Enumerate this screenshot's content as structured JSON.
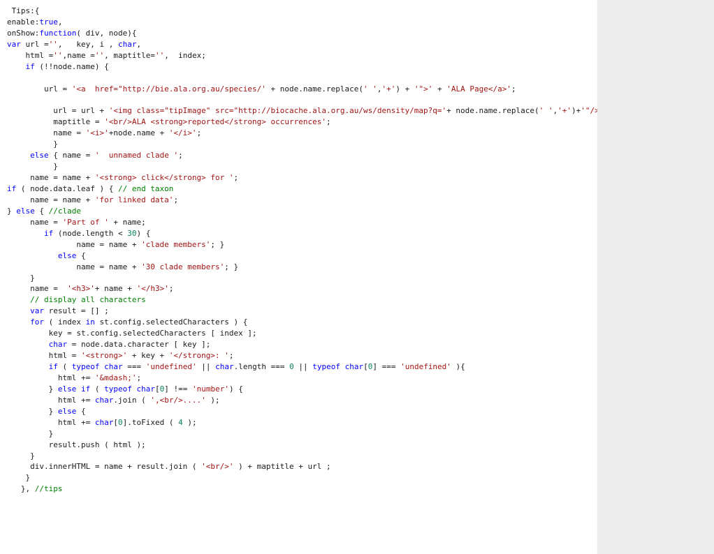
{
  "code_tokens": [
    {
      "indent": " ",
      "parts": [
        {
          "t": "Tips:{",
          "c": "p"
        }
      ]
    },
    {
      "indent": "",
      "parts": [
        {
          "t": "enable:",
          "c": "p"
        },
        {
          "t": "true",
          "c": "b"
        },
        {
          "t": ",",
          "c": "p"
        }
      ]
    },
    {
      "indent": "",
      "parts": [
        {
          "t": "onShow:",
          "c": "p"
        },
        {
          "t": "function",
          "c": "k"
        },
        {
          "t": "( div, node){",
          "c": "p"
        }
      ]
    },
    {
      "indent": "",
      "parts": [
        {
          "t": "var",
          "c": "k"
        },
        {
          "t": " url =",
          "c": "p"
        },
        {
          "t": "''",
          "c": "s"
        },
        {
          "t": ",   key, i , ",
          "c": "p"
        },
        {
          "t": "char",
          "c": "k"
        },
        {
          "t": ",",
          "c": "p"
        }
      ]
    },
    {
      "indent": "    ",
      "parts": [
        {
          "t": "html =",
          "c": "p"
        },
        {
          "t": "''",
          "c": "s"
        },
        {
          "t": ",name =",
          "c": "p"
        },
        {
          "t": "''",
          "c": "s"
        },
        {
          "t": ", maptitle=",
          "c": "p"
        },
        {
          "t": "''",
          "c": "s"
        },
        {
          "t": ",  index;",
          "c": "p"
        }
      ]
    },
    {
      "indent": "    ",
      "parts": [
        {
          "t": "if",
          "c": "k"
        },
        {
          "t": " (!!node.name) {",
          "c": "p"
        }
      ]
    },
    {
      "indent": "",
      "parts": []
    },
    {
      "indent": "        ",
      "parts": [
        {
          "t": "url = ",
          "c": "p"
        },
        {
          "t": "'<a  href=\"http://bie.ala.org.au/species/'",
          "c": "s"
        },
        {
          "t": " + node.name.replace(",
          "c": "p"
        },
        {
          "t": "' '",
          "c": "s"
        },
        {
          "t": ",",
          "c": "p"
        },
        {
          "t": "'+'",
          "c": "s"
        },
        {
          "t": ") + ",
          "c": "p"
        },
        {
          "t": "'\">'",
          "c": "s"
        },
        {
          "t": " + ",
          "c": "p"
        },
        {
          "t": "'ALA Page</a>'",
          "c": "s"
        },
        {
          "t": ";",
          "c": "p"
        }
      ]
    },
    {
      "indent": "",
      "parts": []
    },
    {
      "indent": "          ",
      "parts": [
        {
          "t": "url = url + ",
          "c": "p"
        },
        {
          "t": "'<img class=\"tipImage\" src=\"http://biocache.ala.org.au/ws/density/map?q='",
          "c": "s"
        },
        {
          "t": "+ node.name.replace(",
          "c": "p"
        },
        {
          "t": "' '",
          "c": "s"
        },
        {
          "t": ",",
          "c": "p"
        },
        {
          "t": "'+'",
          "c": "s"
        },
        {
          "t": ")+",
          "c": "p"
        },
        {
          "t": "'\"/>'",
          "c": "s"
        },
        {
          "t": ";",
          "c": "p"
        }
      ]
    },
    {
      "indent": "          ",
      "parts": [
        {
          "t": "maptitle = ",
          "c": "p"
        },
        {
          "t": "'<br/>ALA <strong>reported</strong> occurrences'",
          "c": "s"
        },
        {
          "t": ";",
          "c": "p"
        }
      ]
    },
    {
      "indent": "          ",
      "parts": [
        {
          "t": "name = ",
          "c": "p"
        },
        {
          "t": "'<i>'",
          "c": "s"
        },
        {
          "t": "+node.name + ",
          "c": "p"
        },
        {
          "t": "'</i>'",
          "c": "s"
        },
        {
          "t": ";",
          "c": "p"
        }
      ]
    },
    {
      "indent": "          ",
      "parts": [
        {
          "t": "}",
          "c": "p"
        }
      ]
    },
    {
      "indent": "     ",
      "parts": [
        {
          "t": "else",
          "c": "k"
        },
        {
          "t": " { name = ",
          "c": "p"
        },
        {
          "t": "'  unnamed clade '",
          "c": "s"
        },
        {
          "t": ";",
          "c": "p"
        }
      ]
    },
    {
      "indent": "          ",
      "parts": [
        {
          "t": "}",
          "c": "p"
        }
      ]
    },
    {
      "indent": "     ",
      "parts": [
        {
          "t": "name = name + ",
          "c": "p"
        },
        {
          "t": "'<strong> click</strong> for '",
          "c": "s"
        },
        {
          "t": ";",
          "c": "p"
        }
      ]
    },
    {
      "indent": "",
      "parts": [
        {
          "t": "if",
          "c": "k"
        },
        {
          "t": " ( node.data.leaf ) { ",
          "c": "p"
        },
        {
          "t": "// end taxon",
          "c": "c"
        }
      ]
    },
    {
      "indent": "     ",
      "parts": [
        {
          "t": "name = name + ",
          "c": "p"
        },
        {
          "t": "'for linked data'",
          "c": "s"
        },
        {
          "t": ";",
          "c": "p"
        }
      ]
    },
    {
      "indent": "",
      "parts": [
        {
          "t": "} ",
          "c": "p"
        },
        {
          "t": "else",
          "c": "k"
        },
        {
          "t": " { ",
          "c": "p"
        },
        {
          "t": "//clade",
          "c": "c"
        }
      ]
    },
    {
      "indent": "     ",
      "parts": [
        {
          "t": "name = ",
          "c": "p"
        },
        {
          "t": "'Part of '",
          "c": "s"
        },
        {
          "t": " + name;",
          "c": "p"
        }
      ]
    },
    {
      "indent": "        ",
      "parts": [
        {
          "t": "if",
          "c": "k"
        },
        {
          "t": " (node.length < ",
          "c": "p"
        },
        {
          "t": "30",
          "c": "n"
        },
        {
          "t": ") {",
          "c": "p"
        }
      ]
    },
    {
      "indent": "               ",
      "parts": [
        {
          "t": "name = name + ",
          "c": "p"
        },
        {
          "t": "'clade members'",
          "c": "s"
        },
        {
          "t": "; }",
          "c": "p"
        }
      ]
    },
    {
      "indent": "           ",
      "parts": [
        {
          "t": "else",
          "c": "k"
        },
        {
          "t": " {",
          "c": "p"
        }
      ]
    },
    {
      "indent": "               ",
      "parts": [
        {
          "t": "name = name + ",
          "c": "p"
        },
        {
          "t": "'30 clade members'",
          "c": "s"
        },
        {
          "t": "; }",
          "c": "p"
        }
      ]
    },
    {
      "indent": "     ",
      "parts": [
        {
          "t": "}",
          "c": "p"
        }
      ]
    },
    {
      "indent": "     ",
      "parts": [
        {
          "t": "name =  ",
          "c": "p"
        },
        {
          "t": "'<h3>'",
          "c": "s"
        },
        {
          "t": "+ name + ",
          "c": "p"
        },
        {
          "t": "'</h3>'",
          "c": "s"
        },
        {
          "t": ";",
          "c": "p"
        }
      ]
    },
    {
      "indent": "     ",
      "parts": [
        {
          "t": "// display all characters",
          "c": "c"
        }
      ]
    },
    {
      "indent": "     ",
      "parts": [
        {
          "t": "var",
          "c": "k"
        },
        {
          "t": " result = [] ;",
          "c": "p"
        }
      ]
    },
    {
      "indent": "     ",
      "parts": [
        {
          "t": "for",
          "c": "k"
        },
        {
          "t": " ( index ",
          "c": "p"
        },
        {
          "t": "in",
          "c": "k"
        },
        {
          "t": " st.config.selectedCharacters ) {",
          "c": "p"
        }
      ]
    },
    {
      "indent": "         ",
      "parts": [
        {
          "t": "key = st.config.selectedCharacters [ index ];",
          "c": "p"
        }
      ]
    },
    {
      "indent": "         ",
      "parts": [
        {
          "t": "char",
          "c": "k"
        },
        {
          "t": " = node.data.character [ key ];",
          "c": "p"
        }
      ]
    },
    {
      "indent": "         ",
      "parts": [
        {
          "t": "html = ",
          "c": "p"
        },
        {
          "t": "'<strong>'",
          "c": "s"
        },
        {
          "t": " + key + ",
          "c": "p"
        },
        {
          "t": "'</strong>: '",
          "c": "s"
        },
        {
          "t": ";",
          "c": "p"
        }
      ]
    },
    {
      "indent": "         ",
      "parts": [
        {
          "t": "if",
          "c": "k"
        },
        {
          "t": " ( ",
          "c": "p"
        },
        {
          "t": "typeof",
          "c": "k"
        },
        {
          "t": " ",
          "c": "p"
        },
        {
          "t": "char",
          "c": "k"
        },
        {
          "t": " === ",
          "c": "p"
        },
        {
          "t": "'undefined'",
          "c": "s"
        },
        {
          "t": " || ",
          "c": "p"
        },
        {
          "t": "char",
          "c": "k"
        },
        {
          "t": ".length === ",
          "c": "p"
        },
        {
          "t": "0",
          "c": "n"
        },
        {
          "t": " || ",
          "c": "p"
        },
        {
          "t": "typeof",
          "c": "k"
        },
        {
          "t": " ",
          "c": "p"
        },
        {
          "t": "char",
          "c": "k"
        },
        {
          "t": "[",
          "c": "p"
        },
        {
          "t": "0",
          "c": "n"
        },
        {
          "t": "] === ",
          "c": "p"
        },
        {
          "t": "'undefined'",
          "c": "s"
        },
        {
          "t": " ){",
          "c": "p"
        }
      ]
    },
    {
      "indent": "           ",
      "parts": [
        {
          "t": "html += ",
          "c": "p"
        },
        {
          "t": "'&mdash;'",
          "c": "s"
        },
        {
          "t": ";",
          "c": "p"
        }
      ]
    },
    {
      "indent": "         ",
      "parts": [
        {
          "t": "} ",
          "c": "p"
        },
        {
          "t": "else",
          "c": "k"
        },
        {
          "t": " ",
          "c": "p"
        },
        {
          "t": "if",
          "c": "k"
        },
        {
          "t": " ( ",
          "c": "p"
        },
        {
          "t": "typeof",
          "c": "k"
        },
        {
          "t": " ",
          "c": "p"
        },
        {
          "t": "char",
          "c": "k"
        },
        {
          "t": "[",
          "c": "p"
        },
        {
          "t": "0",
          "c": "n"
        },
        {
          "t": "] !== ",
          "c": "p"
        },
        {
          "t": "'number'",
          "c": "s"
        },
        {
          "t": ") {",
          "c": "p"
        }
      ]
    },
    {
      "indent": "           ",
      "parts": [
        {
          "t": "html += ",
          "c": "p"
        },
        {
          "t": "char",
          "c": "k"
        },
        {
          "t": ".join ( ",
          "c": "p"
        },
        {
          "t": "',<br/>....'",
          "c": "s"
        },
        {
          "t": " );",
          "c": "p"
        }
      ]
    },
    {
      "indent": "         ",
      "parts": [
        {
          "t": "} ",
          "c": "p"
        },
        {
          "t": "else",
          "c": "k"
        },
        {
          "t": " {",
          "c": "p"
        }
      ]
    },
    {
      "indent": "           ",
      "parts": [
        {
          "t": "html += ",
          "c": "p"
        },
        {
          "t": "char",
          "c": "k"
        },
        {
          "t": "[",
          "c": "p"
        },
        {
          "t": "0",
          "c": "n"
        },
        {
          "t": "].toFixed ( ",
          "c": "p"
        },
        {
          "t": "4",
          "c": "n"
        },
        {
          "t": " );",
          "c": "p"
        }
      ]
    },
    {
      "indent": "         ",
      "parts": [
        {
          "t": "}",
          "c": "p"
        }
      ]
    },
    {
      "indent": "         ",
      "parts": [
        {
          "t": "result.push ( html );",
          "c": "p"
        }
      ]
    },
    {
      "indent": "     ",
      "parts": [
        {
          "t": "}",
          "c": "p"
        }
      ]
    },
    {
      "indent": "     ",
      "parts": [
        {
          "t": "div.innerHTML = name + result.join ( ",
          "c": "p"
        },
        {
          "t": "'<br/>'",
          "c": "s"
        },
        {
          "t": " ) + maptitle + url ;",
          "c": "p"
        }
      ]
    },
    {
      "indent": "    ",
      "parts": [
        {
          "t": "}",
          "c": "p"
        }
      ]
    },
    {
      "indent": "   ",
      "parts": [
        {
          "t": "}, ",
          "c": "p"
        },
        {
          "t": "//tips",
          "c": "c"
        }
      ]
    }
  ]
}
